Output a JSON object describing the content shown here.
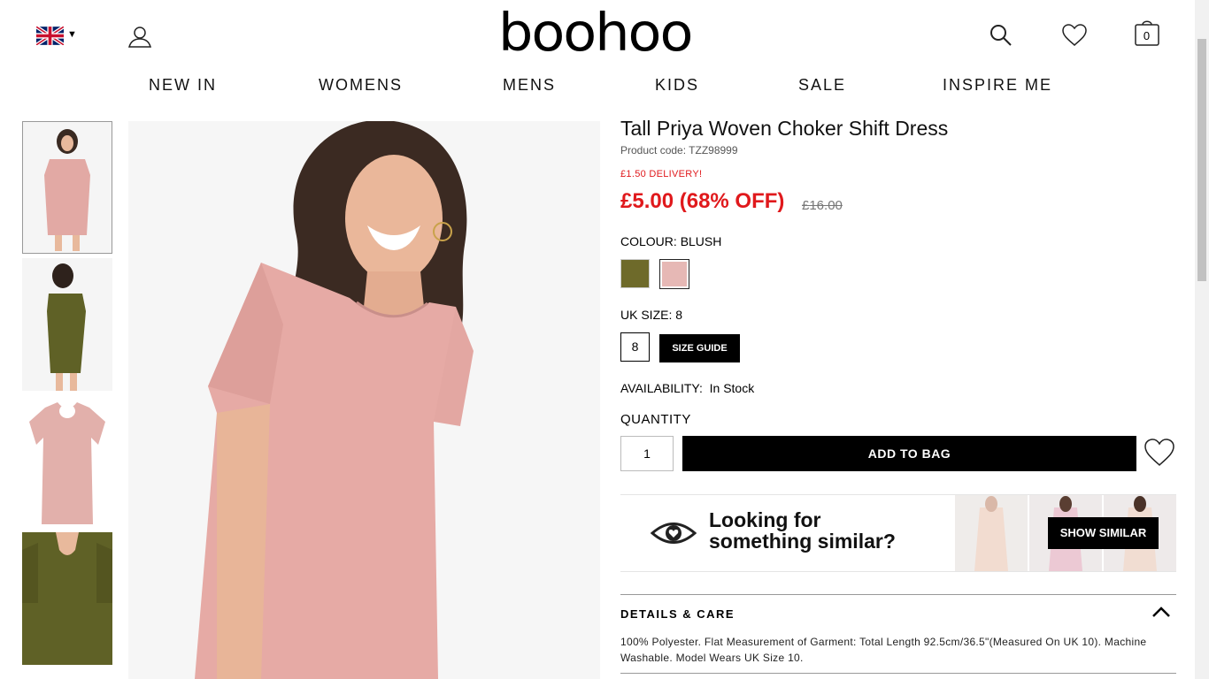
{
  "header": {
    "logo": "boohoo",
    "bag_count": "0"
  },
  "nav": {
    "items": [
      "NEW IN",
      "WOMENS",
      "MENS",
      "KIDS",
      "SALE",
      "INSPIRE ME"
    ]
  },
  "product": {
    "title": "Tall Priya Woven Choker Shift Dress",
    "code": "Product code: TZZ98999",
    "delivery": "£1.50 DELIVERY!",
    "price": "£5.00 (68% OFF)",
    "was_price": "£16.00",
    "colour_label": "COLOUR:",
    "colour_value": "BLUSH",
    "size_label": "UK SIZE:",
    "size_value": "8",
    "size_option": "8",
    "size_guide": "SIZE GUIDE",
    "availability_label": "AVAILABILITY:",
    "availability_value": "In Stock",
    "quantity_label": "QUANTITY",
    "quantity_value": "1",
    "add_to_bag": "ADD TO BAG"
  },
  "similar": {
    "line1": "Looking for",
    "line2": "something similar?",
    "button": "SHOW SIMILAR"
  },
  "details": {
    "heading": "DETAILS & CARE",
    "body": "100% Polyester. Flat Measurement of Garment: Total Length 92.5cm/36.5\"(Measured On UK 10). Machine Washable. Model Wears UK Size 10."
  },
  "colors": {
    "accent_red": "#e0191c",
    "blush": "#e6b8b5",
    "olive": "#6e6a2a"
  }
}
